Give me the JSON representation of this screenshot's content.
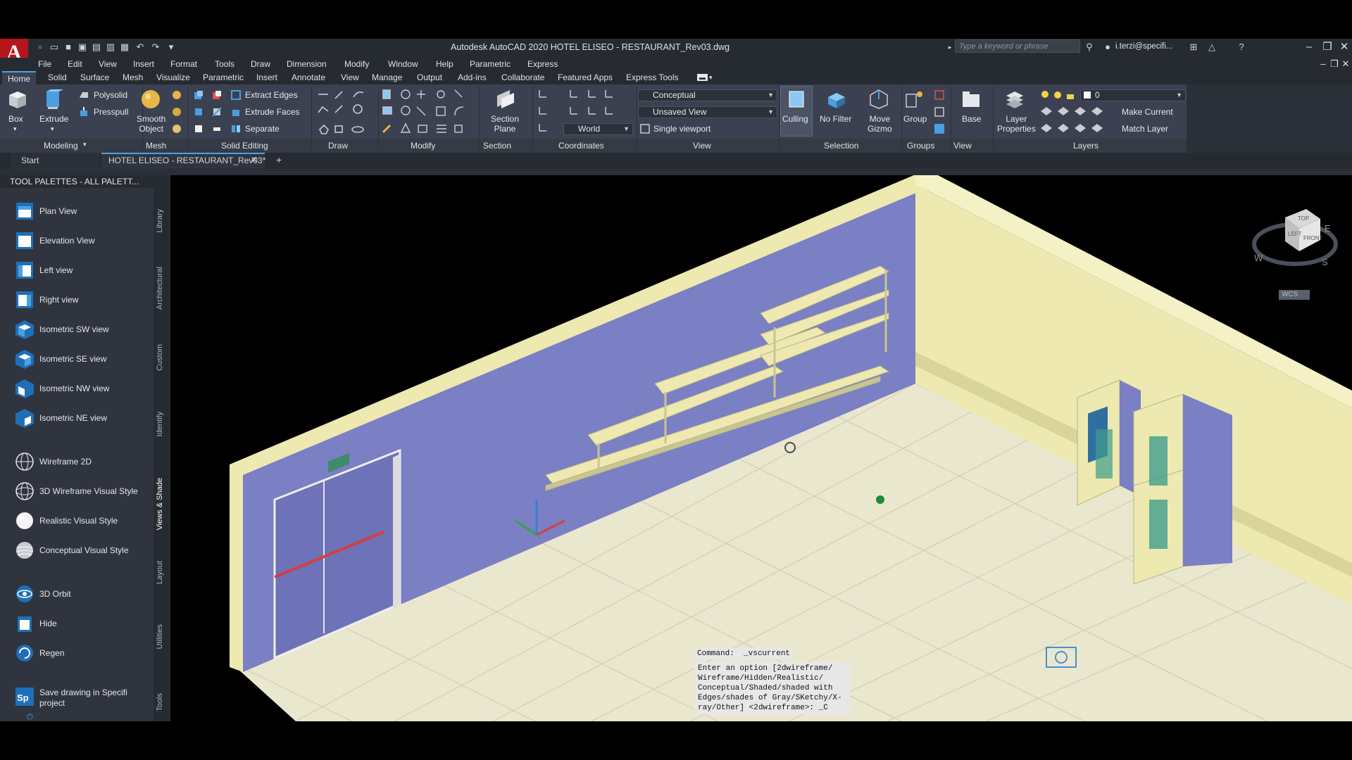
{
  "titlebar": {
    "title": "Autodesk AutoCAD 2020   HOTEL ELISEO - RESTAURANT_Rev03.dwg",
    "search_placeholder": "Type a keyword or phrase",
    "user": "i.terzi@specifi..."
  },
  "menubar": [
    "File",
    "Edit",
    "View",
    "Insert",
    "Format",
    "Tools",
    "Draw",
    "Dimension",
    "Modify",
    "Window",
    "Help",
    "Parametric",
    "Express"
  ],
  "ribbon_tabs": [
    "Home",
    "Solid",
    "Surface",
    "Mesh",
    "Visualize",
    "Parametric",
    "Insert",
    "Annotate",
    "View",
    "Manage",
    "Output",
    "Add-ins",
    "Collaborate",
    "Featured Apps",
    "Express Tools"
  ],
  "ribbon": {
    "modeling": {
      "box": "Box",
      "extrude": "Extrude",
      "polysolid": "Polysolid",
      "presspull": "Presspull",
      "title": "Modeling"
    },
    "mesh": {
      "smooth": "Smooth\nObject",
      "title": "Mesh"
    },
    "solid_editing": {
      "extract_edges": "Extract Edges",
      "extrude_faces": "Extrude Faces",
      "separate": "Separate",
      "title": "Solid Editing"
    },
    "draw": {
      "title": "Draw"
    },
    "modify": {
      "title": "Modify"
    },
    "section": {
      "plane": "Section\nPlane",
      "title": "Section"
    },
    "coordinates": {
      "world": "World",
      "title": "Coordinates"
    },
    "view": {
      "visual_style": "Conceptual",
      "named_view": "Unsaved View",
      "viewport": "Single viewport",
      "title": "View"
    },
    "selection": {
      "culling": "Culling",
      "no_filter": "No Filter",
      "move_gizmo": "Move\nGizmo",
      "title": "Selection"
    },
    "groups": {
      "group": "Group",
      "title": "Groups"
    },
    "view2": {
      "base": "Base",
      "title": "View"
    },
    "layers": {
      "layer_properties": "Layer\nProperties",
      "current_layer": "0",
      "make_current": "Make Current",
      "match_layer": "Match Layer",
      "title": "Layers"
    }
  },
  "doc_tabs": {
    "start": "Start",
    "active": "HOTEL ELISEO - RESTAURANT_Rev03*"
  },
  "palette": {
    "title": "TOOL PALETTES - ALL PALETT...",
    "items": [
      {
        "label": "Plan View",
        "icon": "plan-view-icon"
      },
      {
        "label": "Elevation View",
        "icon": "elevation-view-icon"
      },
      {
        "label": "Left view",
        "icon": "left-view-icon"
      },
      {
        "label": "Right view",
        "icon": "right-view-icon"
      },
      {
        "label": "Isometric SW view",
        "icon": "iso-sw-icon"
      },
      {
        "label": "Isometric SE view",
        "icon": "iso-se-icon"
      },
      {
        "label": "Isometric NW view",
        "icon": "iso-nw-icon"
      },
      {
        "label": "Isometric NE view",
        "icon": "iso-ne-icon"
      },
      {
        "label": "Wireframe 2D",
        "icon": "wireframe-2d-icon"
      },
      {
        "label": "3D Wireframe Visual Style",
        "icon": "wireframe-3d-icon"
      },
      {
        "label": "Realistic Visual Style",
        "icon": "realistic-icon"
      },
      {
        "label": "Conceptual Visual Style",
        "icon": "conceptual-icon"
      },
      {
        "label": "3D Orbit",
        "icon": "orbit-icon"
      },
      {
        "label": "Hide",
        "icon": "hide-icon"
      },
      {
        "label": "Regen",
        "icon": "regen-icon"
      },
      {
        "label": "Save drawing in Specifi project",
        "icon": "specifi-icon"
      }
    ],
    "vertical_tabs": [
      "Library",
      "Architectural",
      "Custom",
      "Identify",
      "Views & Shade",
      "Layout",
      "Utilities",
      "Tools"
    ]
  },
  "viewcube": {
    "top": "TOP",
    "left": "LEFT",
    "front": "FRONT",
    "w": "W",
    "s": "S",
    "e": "E",
    "wcs": "WCS"
  },
  "command": {
    "echo": "Command:  _vscurrent",
    "prompt": "Enter an option [2dwireframe/\nWireframe/Hidden/Realistic/\nConceptual/Shaded/shaded with\nEdges/shades of Gray/SKetchy/X-\nray/Other] <2dwireframe>: _C"
  },
  "colors": {
    "accent": "#4aa3df",
    "ribbon": "#3b4150",
    "wall_blue": "#7b7fc4",
    "wall_cream": "#ede9b0",
    "floor": "#eae7cf"
  }
}
